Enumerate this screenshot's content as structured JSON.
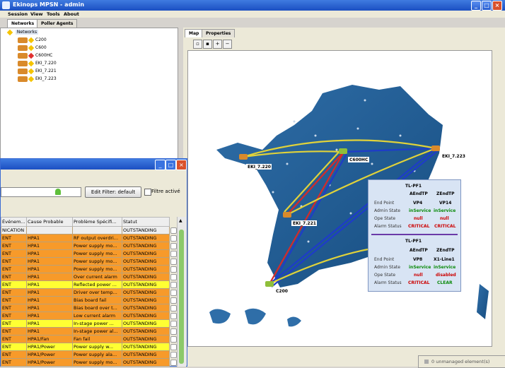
{
  "app": {
    "title": "Ekinops MPSN - admin"
  },
  "menu": [
    "Session",
    "View",
    "Tools",
    "About"
  ],
  "left_tabs": [
    "Networks",
    "Poller Agents"
  ],
  "tree": {
    "root": "Networks",
    "nodes": [
      "C200",
      "C600",
      "C600HC",
      "EKI_7.220",
      "EKI_7.221",
      "EKI_7.223"
    ]
  },
  "map_tabs": [
    "Map",
    "Properties"
  ],
  "map": {
    "labels": [
      "C600HC",
      "EKI_7.223",
      "EKI_7.220",
      "EKI_7.221",
      "C200"
    ]
  },
  "alarm": {
    "edit_filter": "Edit Filter: default",
    "filter_active": "Filtre activé",
    "columns": [
      "Événem...",
      "Cause Probable",
      "Problème Spécifi...",
      "Statut"
    ],
    "rows": [
      {
        "sev": "comm",
        "c0": "NICATION",
        "c1": "",
        "c2": "",
        "c3": "OUTSTANDING"
      },
      {
        "sev": "major",
        "c0": "ENT",
        "c1": "HPA1",
        "c2": "RF output overdri...",
        "c3": "OUTSTANDING"
      },
      {
        "sev": "major",
        "c0": "ENT",
        "c1": "HPA1",
        "c2": "Power supply mo...",
        "c3": "OUTSTANDING"
      },
      {
        "sev": "major",
        "c0": "ENT",
        "c1": "HPA1",
        "c2": "Power supply mo...",
        "c3": "OUTSTANDING"
      },
      {
        "sev": "major",
        "c0": "ENT",
        "c1": "HPA1",
        "c2": "Power supply mo...",
        "c3": "OUTSTANDING"
      },
      {
        "sev": "major",
        "c0": "ENT",
        "c1": "HPA1",
        "c2": "Power supply mo...",
        "c3": "OUTSTANDING"
      },
      {
        "sev": "major",
        "c0": "ENT",
        "c1": "HPA1",
        "c2": "Over current alarm",
        "c3": "OUTSTANDING"
      },
      {
        "sev": "minor",
        "c0": "ENT",
        "c1": "HPA1",
        "c2": "Reflected power ...",
        "c3": "OUTSTANDING"
      },
      {
        "sev": "major",
        "c0": "ENT",
        "c1": "HPA1",
        "c2": "Driver over temp...",
        "c3": "OUTSTANDING"
      },
      {
        "sev": "major",
        "c0": "ENT",
        "c1": "HPA1",
        "c2": "Bias board fail",
        "c3": "OUTSTANDING"
      },
      {
        "sev": "major",
        "c0": "ENT",
        "c1": "HPA1",
        "c2": "Bias board over t...",
        "c3": "OUTSTANDING"
      },
      {
        "sev": "major",
        "c0": "ENT",
        "c1": "HPA1",
        "c2": "Low current alarm",
        "c3": "OUTSTANDING"
      },
      {
        "sev": "minor",
        "c0": "ENT",
        "c1": "HPA1",
        "c2": "In-stage power ...",
        "c3": "OUTSTANDING"
      },
      {
        "sev": "major",
        "c0": "ENT",
        "c1": "HPA1",
        "c2": "In-stage power al...",
        "c3": "OUTSTANDING"
      },
      {
        "sev": "major",
        "c0": "ENT",
        "c1": "HPA1/Fan",
        "c2": "Fan fail",
        "c3": "OUTSTANDING"
      },
      {
        "sev": "minor",
        "c0": "ENT",
        "c1": "HPA1/Power",
        "c2": "Power supply w...",
        "c3": "OUTSTANDING"
      },
      {
        "sev": "major",
        "c0": "ENT",
        "c1": "HPA1/Power",
        "c2": "Power supply ala...",
        "c3": "OUTSTANDING"
      },
      {
        "sev": "major",
        "c0": "ENT",
        "c1": "HPA1/Power",
        "c2": "Power supply mo...",
        "c3": "OUTSTANDING"
      }
    ]
  },
  "tooltip": {
    "sections": [
      {
        "title": "TL-PF1",
        "col_a": "AEndTP",
        "col_z": "ZEndTP",
        "rows": [
          {
            "label": "End Point",
            "a": "VP4",
            "z": "VP14"
          },
          {
            "label": "Admin State",
            "a": "inService",
            "z": "inService"
          },
          {
            "label": "Ope State",
            "a": "null",
            "z": "null"
          },
          {
            "label": "Alarm Status",
            "a": "CRITICAL",
            "z": "CRITICAL"
          }
        ]
      },
      {
        "title": "TL-PF1",
        "col_a": "AEndTP",
        "col_z": "ZEndTP",
        "rows": [
          {
            "label": "End Point",
            "a": "VP8",
            "z": "X1-Line1"
          },
          {
            "label": "Admin State",
            "a": "inService",
            "z": "inService"
          },
          {
            "label": "Ope State",
            "a": "null",
            "z": "disabled"
          },
          {
            "label": "Alarm Status",
            "a": "CRITICAL",
            "z": "CLEAR"
          }
        ]
      }
    ]
  },
  "status": {
    "text": "0 unmanaged element(s)"
  },
  "colors": {
    "critical": "#cc0000",
    "in_service": "#0a8a0a",
    "clear": "#0a8a0a",
    "major": "#f79a2a",
    "minor": "#ffff33"
  }
}
